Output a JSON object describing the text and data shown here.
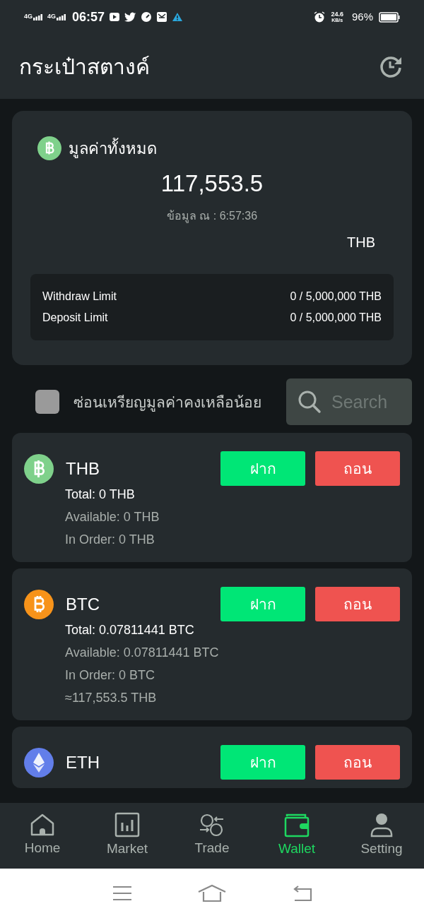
{
  "status_bar": {
    "networks": [
      "4G",
      "4G"
    ],
    "time": "06:57",
    "speed": "24.6",
    "speed_unit": "KB/s",
    "battery": "96%"
  },
  "header": {
    "title": "กระเป๋าสตางค์"
  },
  "summary": {
    "label": "มูลค่าทั้งหมด",
    "value": "117,553.5",
    "updated": "ข้อมูล ณ : 6:57:36",
    "currency": "THB",
    "limits": [
      {
        "label": "Withdraw Limit",
        "value": "0 / 5,000,000 THB"
      },
      {
        "label": "Deposit Limit",
        "value": "0 / 5,000,000 THB"
      }
    ]
  },
  "filter": {
    "hide_small_label": "ซ่อนเหรียญมูลค่าคงเหลือน้อย",
    "checked": false,
    "search_placeholder": "Search"
  },
  "coins": [
    {
      "kind": "thb",
      "symbol": "THB",
      "deposit": "ฝาก",
      "withdraw": "ถอน",
      "total": "Total: 0 THB",
      "available": "Available: 0 THB",
      "in_order": "In Order: 0 THB"
    },
    {
      "kind": "btc",
      "symbol": "BTC",
      "deposit": "ฝาก",
      "withdraw": "ถอน",
      "total": "Total: 0.07811441 BTC",
      "available": "Available: 0.07811441 BTC",
      "in_order": "In Order: 0 BTC",
      "approx": "≈117,553.5 THB"
    },
    {
      "kind": "eth",
      "symbol": "ETH",
      "deposit": "ฝาก",
      "withdraw": "ถอน"
    }
  ],
  "nav": [
    {
      "kind": "home",
      "label": "Home",
      "selected": false
    },
    {
      "kind": "market",
      "label": "Market",
      "selected": false
    },
    {
      "kind": "trade",
      "label": "Trade",
      "selected": false
    },
    {
      "kind": "wallet",
      "label": "Wallet",
      "selected": true
    },
    {
      "kind": "setting",
      "label": "Setting",
      "selected": false
    }
  ]
}
